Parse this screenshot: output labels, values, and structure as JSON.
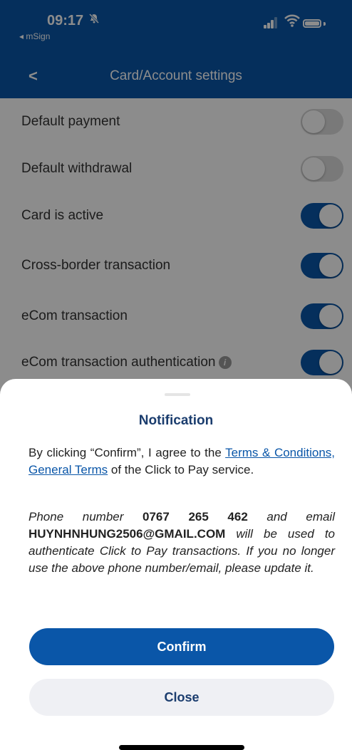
{
  "status": {
    "time": "09:17",
    "back_app": "◂ mSign"
  },
  "header": {
    "back_glyph": "<",
    "title": "Card/Account settings"
  },
  "settings": [
    {
      "label": "Default payment",
      "on": false,
      "info": false
    },
    {
      "label": "Default withdrawal",
      "on": false,
      "info": false
    },
    {
      "label": "Card is active",
      "on": true,
      "info": false
    },
    {
      "label": "Cross-border transaction",
      "on": true,
      "info": false
    },
    {
      "label": "eCom transaction",
      "on": true,
      "info": false
    },
    {
      "label": "eCom transaction authentication",
      "on": true,
      "info": true
    }
  ],
  "sheet": {
    "title": "Notification",
    "p1_before": "By clicking “Confirm”, I agree to the ",
    "p1_link": "Terms & Conditions, General Terms",
    "p1_after": " of the Click to Pay service.",
    "p2_a": "Phone number ",
    "phone": "0767 265 462",
    "p2_b": " and email ",
    "email": "HUYNHNHUNG2506@GMAIL.COM",
    "p2_c": " will be used to authenticate Click to Pay transactions. If you no longer use the above phone number/email, please update it.",
    "confirm_label": "Confirm",
    "close_label": "Close"
  },
  "colors": {
    "primary": "#0a56a8",
    "title_navy": "#1b3d6e",
    "toggle_off": "#dcdcdc",
    "secondary_btn_bg": "#eff0f4"
  },
  "icons": {
    "silent": "bell-slash-icon",
    "signal": "signal-icon",
    "wifi": "wifi-icon",
    "battery": "battery-icon",
    "info": "info-icon"
  }
}
